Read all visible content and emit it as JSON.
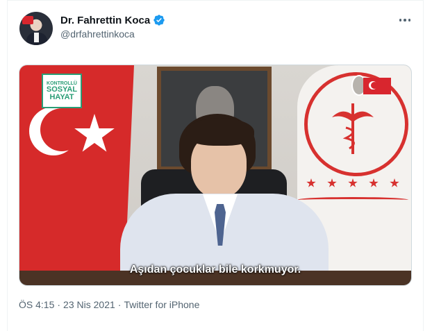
{
  "author": {
    "name": "Dr. Fahrettin Koca",
    "handle": "@drfahrettinkoca",
    "verified": true,
    "verified_color": "#1d9bf0"
  },
  "media": {
    "brand_line1": "KONTROLLÜ",
    "brand_line2": "SOSYAL",
    "brand_line3": "HAYAT",
    "subtitle": "Aşıdan çocuklar bile korkmuyor."
  },
  "meta": {
    "time": "ÖS 4:15",
    "separator": "·",
    "date": "23 Nis 2021",
    "source": "Twitter for iPhone"
  },
  "icons": {
    "more": "more-horizontal-icon",
    "verified": "verified-badge-icon"
  },
  "colors": {
    "text_primary": "#0f1419",
    "text_secondary": "#536471",
    "flag_red": "#d62a2a",
    "brand_green": "#2a9d76"
  }
}
